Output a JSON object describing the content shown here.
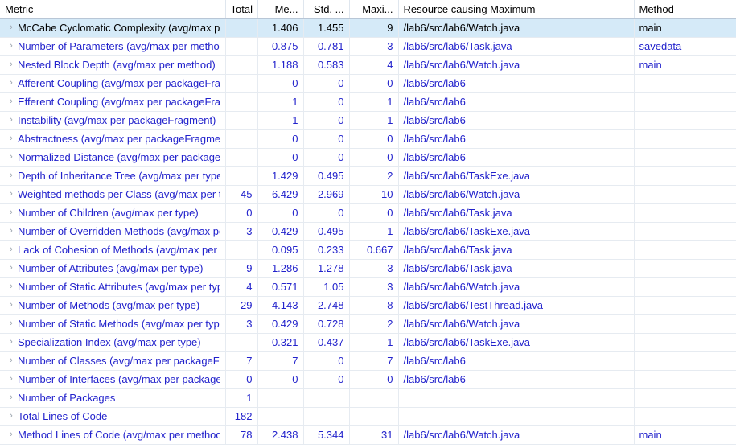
{
  "table": {
    "columns": [
      {
        "key": "metric",
        "label": "Metric",
        "align": "left"
      },
      {
        "key": "total",
        "label": "Total",
        "align": "right"
      },
      {
        "key": "mean",
        "label": "Me...",
        "align": "right"
      },
      {
        "key": "std",
        "label": "Std. ...",
        "align": "right"
      },
      {
        "key": "max",
        "label": "Maxi...",
        "align": "right"
      },
      {
        "key": "resource",
        "label": "Resource causing Maximum",
        "align": "left"
      },
      {
        "key": "method",
        "label": "Method",
        "align": "left"
      }
    ],
    "expand_icon": "›",
    "selected_row_index": 0,
    "rows": [
      {
        "metric": "McCabe Cyclomatic Complexity (avg/max per method)",
        "total": "",
        "mean": "1.406",
        "std": "1.455",
        "max": "9",
        "resource": "/lab6/src/lab6/Watch.java",
        "method": "main",
        "selected": true
      },
      {
        "metric": "Number of Parameters (avg/max per method)",
        "total": "",
        "mean": "0.875",
        "std": "0.781",
        "max": "3",
        "resource": "/lab6/src/lab6/Task.java",
        "method": "savedata",
        "selected": false
      },
      {
        "metric": "Nested Block Depth (avg/max per method)",
        "total": "",
        "mean": "1.188",
        "std": "0.583",
        "max": "4",
        "resource": "/lab6/src/lab6/Watch.java",
        "method": "main",
        "selected": false
      },
      {
        "metric": "Afferent Coupling (avg/max per packageFragment)",
        "total": "",
        "mean": "0",
        "std": "0",
        "max": "0",
        "resource": "/lab6/src/lab6",
        "method": "",
        "selected": false
      },
      {
        "metric": "Efferent Coupling (avg/max per packageFragment)",
        "total": "",
        "mean": "1",
        "std": "0",
        "max": "1",
        "resource": "/lab6/src/lab6",
        "method": "",
        "selected": false
      },
      {
        "metric": "Instability (avg/max per packageFragment)",
        "total": "",
        "mean": "1",
        "std": "0",
        "max": "1",
        "resource": "/lab6/src/lab6",
        "method": "",
        "selected": false
      },
      {
        "metric": "Abstractness (avg/max per packageFragment)",
        "total": "",
        "mean": "0",
        "std": "0",
        "max": "0",
        "resource": "/lab6/src/lab6",
        "method": "",
        "selected": false
      },
      {
        "metric": "Normalized Distance (avg/max per packageFragment)",
        "total": "",
        "mean": "0",
        "std": "0",
        "max": "0",
        "resource": "/lab6/src/lab6",
        "method": "",
        "selected": false
      },
      {
        "metric": "Depth of Inheritance Tree (avg/max per type)",
        "total": "",
        "mean": "1.429",
        "std": "0.495",
        "max": "2",
        "resource": "/lab6/src/lab6/TaskExe.java",
        "method": "",
        "selected": false
      },
      {
        "metric": "Weighted methods per Class (avg/max per type)",
        "total": "45",
        "mean": "6.429",
        "std": "2.969",
        "max": "10",
        "resource": "/lab6/src/lab6/Watch.java",
        "method": "",
        "selected": false
      },
      {
        "metric": "Number of Children (avg/max per type)",
        "total": "0",
        "mean": "0",
        "std": "0",
        "max": "0",
        "resource": "/lab6/src/lab6/Task.java",
        "method": "",
        "selected": false
      },
      {
        "metric": "Number of Overridden Methods (avg/max per type)",
        "total": "3",
        "mean": "0.429",
        "std": "0.495",
        "max": "1",
        "resource": "/lab6/src/lab6/TaskExe.java",
        "method": "",
        "selected": false
      },
      {
        "metric": "Lack of Cohesion of Methods (avg/max per type)",
        "total": "",
        "mean": "0.095",
        "std": "0.233",
        "max": "0.667",
        "resource": "/lab6/src/lab6/Task.java",
        "method": "",
        "selected": false
      },
      {
        "metric": "Number of Attributes (avg/max per type)",
        "total": "9",
        "mean": "1.286",
        "std": "1.278",
        "max": "3",
        "resource": "/lab6/src/lab6/Task.java",
        "method": "",
        "selected": false
      },
      {
        "metric": "Number of Static Attributes (avg/max per type)",
        "total": "4",
        "mean": "0.571",
        "std": "1.05",
        "max": "3",
        "resource": "/lab6/src/lab6/Watch.java",
        "method": "",
        "selected": false
      },
      {
        "metric": "Number of Methods (avg/max per type)",
        "total": "29",
        "mean": "4.143",
        "std": "2.748",
        "max": "8",
        "resource": "/lab6/src/lab6/TestThread.java",
        "method": "",
        "selected": false
      },
      {
        "metric": "Number of Static Methods (avg/max per type)",
        "total": "3",
        "mean": "0.429",
        "std": "0.728",
        "max": "2",
        "resource": "/lab6/src/lab6/Watch.java",
        "method": "",
        "selected": false
      },
      {
        "metric": "Specialization Index (avg/max per type)",
        "total": "",
        "mean": "0.321",
        "std": "0.437",
        "max": "1",
        "resource": "/lab6/src/lab6/TaskExe.java",
        "method": "",
        "selected": false
      },
      {
        "metric": "Number of Classes (avg/max per packageFragment)",
        "total": "7",
        "mean": "7",
        "std": "0",
        "max": "7",
        "resource": "/lab6/src/lab6",
        "method": "",
        "selected": false
      },
      {
        "metric": "Number of Interfaces (avg/max per packageFragment)",
        "total": "0",
        "mean": "0",
        "std": "0",
        "max": "0",
        "resource": "/lab6/src/lab6",
        "method": "",
        "selected": false
      },
      {
        "metric": "Number of Packages",
        "total": "1",
        "mean": "",
        "std": "",
        "max": "",
        "resource": "",
        "method": "",
        "selected": false
      },
      {
        "metric": "Total Lines of Code",
        "total": "182",
        "mean": "",
        "std": "",
        "max": "",
        "resource": "",
        "method": "",
        "selected": false
      },
      {
        "metric": "Method Lines of Code (avg/max per method)",
        "total": "78",
        "mean": "2.438",
        "std": "5.344",
        "max": "31",
        "resource": "/lab6/src/lab6/Watch.java",
        "method": "main",
        "selected": false
      }
    ]
  },
  "colors": {
    "link_text": "#2222cc",
    "header_text": "#000000",
    "selection_background": "#d5eaf8",
    "grid_line": "#e6ebf1",
    "header_rule": "#b8c6d6"
  }
}
